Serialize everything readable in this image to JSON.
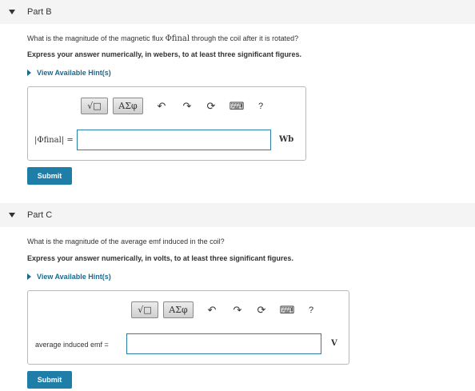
{
  "partB": {
    "title": "Part B",
    "question_before": "What is the magnitude of the magnetic flux ",
    "question_symbol": "Φfinal",
    "question_after": " through the coil after it is rotated?",
    "instruction": "Express your answer numerically, in webers, to at least three significant figures.",
    "hint": "View Available Hint(s)",
    "toolbar": {
      "template_label": "√□",
      "greek_label": "ΑΣφ",
      "undo": "↶",
      "redo": "↷",
      "reset": "⟳",
      "keyboard": "⌨",
      "help": "?"
    },
    "input_label": "|Φfinal| =",
    "input_value": "",
    "unit": "Wb",
    "submit_label": "Submit"
  },
  "partC": {
    "title": "Part C",
    "question": "What is the magnitude of the average emf induced in the coil?",
    "instruction": "Express your answer numerically, in volts, to at least three significant figures.",
    "hint": "View Available Hint(s)",
    "toolbar": {
      "template_label": "√□",
      "greek_label": "ΑΣφ",
      "undo": "↶",
      "redo": "↷",
      "reset": "⟳",
      "keyboard": "⌨",
      "help": "?"
    },
    "input_label": "average induced emf =",
    "input_value": "",
    "unit": "V",
    "submit_label": "Submit"
  },
  "colors": {
    "accent": "#1e7ea8",
    "header_bg": "#f4f4f4",
    "link": "#1a6a8f"
  }
}
